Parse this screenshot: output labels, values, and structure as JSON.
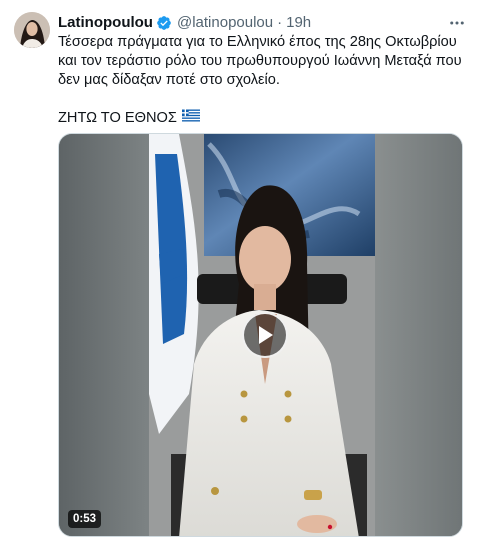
{
  "tweet": {
    "display_name": "Latinopoulou",
    "handle": "@latinopoulou",
    "separator": "·",
    "time": "19h",
    "verified_icon": "verified-badge-icon",
    "more_icon": "more-options-icon",
    "text_lines": [
      "Τέσσερα πράγματα για το Ελληνικό έπος της 28ης Οκτωβρίου",
      "και τον τεράστιο ρόλο του πρωθυπουργού Ιωάννη Μεταξά που",
      "δεν μας δίδαξαν ποτέ στο σχολείο."
    ],
    "slogan": "ΖΗΤΩ ΤΟ ΕΘΝΟΣ",
    "flag_icon": "greek-flag-icon",
    "video": {
      "duration": "0:53",
      "play_icon": "play-icon"
    }
  },
  "colors": {
    "text_primary": "#0f1419",
    "text_secondary": "#536471",
    "verified_blue": "#1d9bf0",
    "flag_blue": "#0d5eaf",
    "border": "#cfd9de"
  }
}
